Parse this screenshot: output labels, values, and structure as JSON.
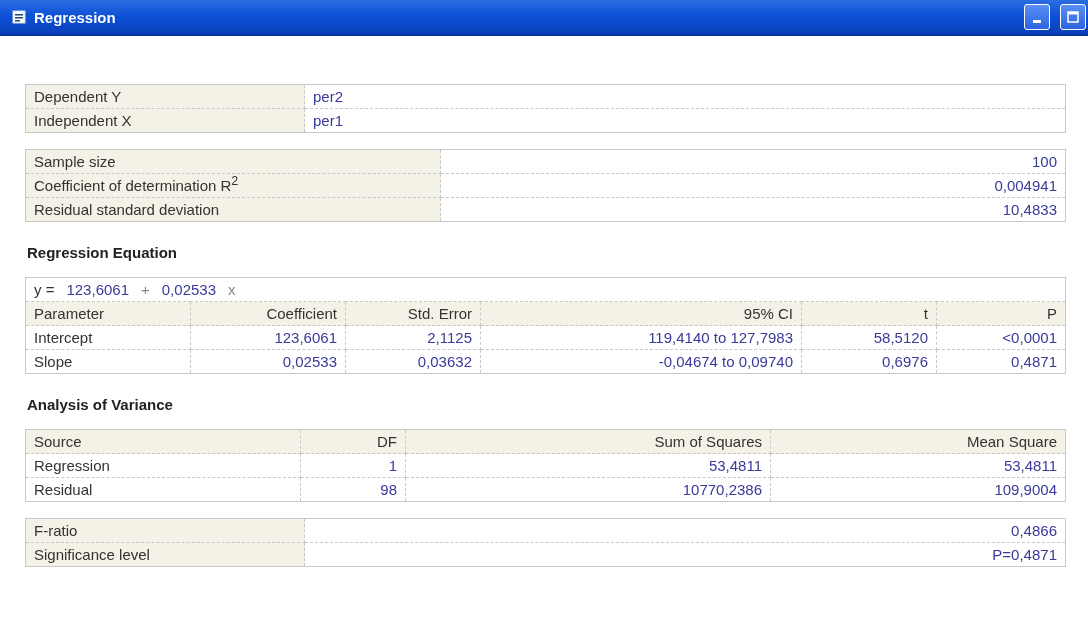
{
  "window": {
    "title": "Regression"
  },
  "variables": [
    {
      "label": "Dependent Y",
      "value": "per2"
    },
    {
      "label": "Independent X",
      "value": "per1"
    }
  ],
  "summary": [
    {
      "label": "Sample size",
      "value": "100"
    },
    {
      "label": "Coefficient of determination R$^{2}$",
      "value": "0,004941"
    },
    {
      "label": "Residual standard deviation",
      "value": "10,4833"
    }
  ],
  "regression_equation": {
    "heading": "Regression Equation",
    "equation": [
      {
        "kind": "symbol",
        "text": "y ="
      },
      {
        "kind": "value",
        "text": "123,6061"
      },
      {
        "kind": "operator",
        "text": "+"
      },
      {
        "kind": "value",
        "text": "0,02533"
      },
      {
        "kind": "operator",
        "text": "x"
      }
    ],
    "columns": [
      "Parameter",
      "Coefficient",
      "Std. Error",
      "95% CI",
      "t",
      "P"
    ],
    "rows": [
      [
        "Intercept",
        "123,6061",
        "2,1125",
        "119,4140 to 127,7983",
        "58,5120",
        "<0,0001"
      ],
      [
        "Slope",
        "0,02533",
        "0,03632",
        "-0,04674 to 0,09740",
        "0,6976",
        "0,4871"
      ]
    ]
  },
  "analysis_of_variance": {
    "heading": "Analysis of Variance",
    "columns": [
      "Source",
      "DF",
      "Sum of Squares",
      "Mean Square"
    ],
    "rows": [
      [
        "Regression",
        "1",
        "53,4811",
        "53,4811"
      ],
      [
        "Residual",
        "98",
        "10770,2386",
        "109,9004"
      ]
    ]
  },
  "tests": [
    {
      "label": "F-ratio",
      "value": "0,4866"
    },
    {
      "label": "Significance level",
      "value": "P=0,4871"
    }
  ]
}
